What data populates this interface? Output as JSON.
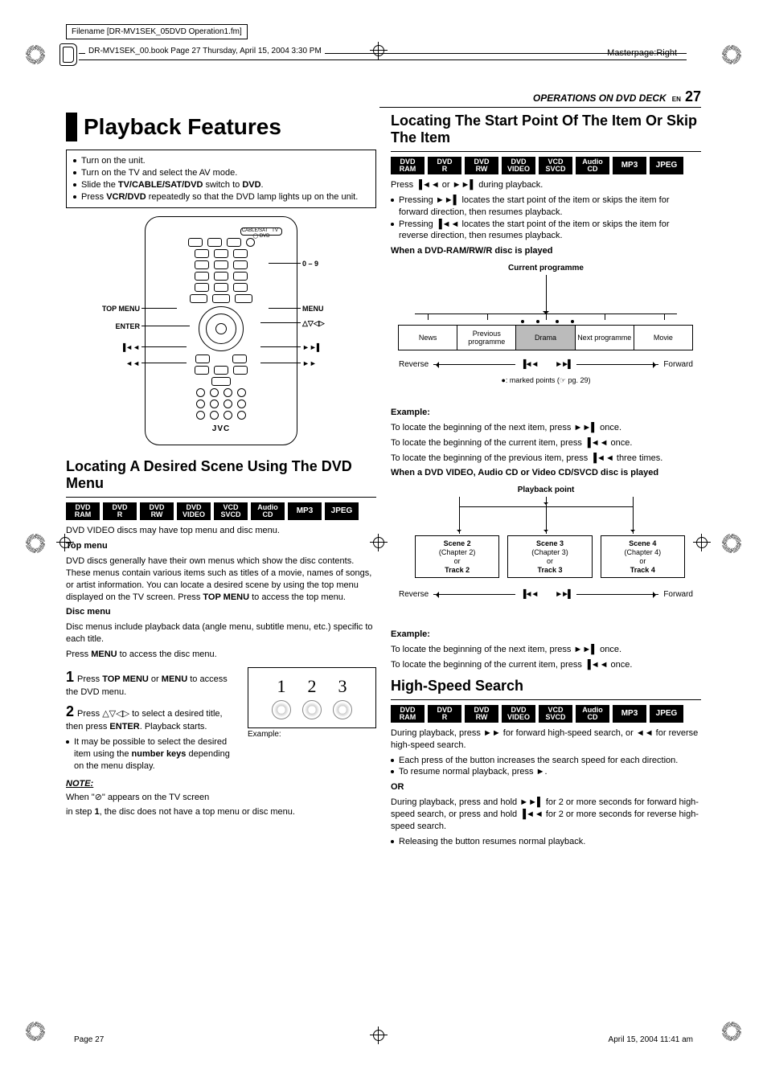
{
  "meta": {
    "filename_box": "Filename [DR-MV1SEK_05DVD Operation1.fm]",
    "bookline": "DR-MV1SEK_00.book  Page 27  Thursday, April 15, 2004  3:30 PM",
    "masterpage": "Masterpage:Right",
    "footer_left": "Page 27",
    "footer_right": "April 15, 2004 11:41 am"
  },
  "header": {
    "section": "OPERATIONS ON DVD DECK",
    "lang": "EN",
    "page": "27"
  },
  "formats": {
    "all": [
      "DVD\nRAM",
      "DVD\nR",
      "DVD\nRW",
      "DVD\nVIDEO",
      "VCD\nSVCD",
      "Audio\nCD",
      "MP3",
      "JPEG"
    ]
  },
  "left": {
    "title": "Playback Features",
    "box": {
      "b1": "Turn on the unit.",
      "b2": "Turn on the TV and select the AV mode.",
      "b3_pre": "Slide the ",
      "b3_b1": "TV/CABLE/SAT/DVD",
      "b3_mid": " switch to ",
      "b3_b2": "DVD",
      "b3_post": ".",
      "b4_pre": "Press ",
      "b4_b": "VCR/DVD",
      "b4_post": " repeatedly so that the DVD lamp lights up on the unit."
    },
    "remote": {
      "top_menu": "TOP MENU",
      "enter": "ENTER",
      "prev": "▐◄◄",
      "rew": "◄◄",
      "menu": "MENU",
      "arrows": "△▽◁▷",
      "next": "►►▌",
      "ff": "►►",
      "numlabel": "0 – 9",
      "brand": "JVC"
    },
    "h2a": "Locating A Desired Scene Using The DVD Menu",
    "p1": "DVD VIDEO discs may have top menu and disc menu.",
    "topmenu_h": "Top menu",
    "topmenu_p_pre": "DVD discs generally have their own menus which show the disc contents. These menus contain various items such as titles of a movie, names of songs, or artist information. You can locate a desired scene by using the top menu displayed on the TV screen. Press ",
    "topmenu_p_b": "TOP MENU",
    "topmenu_p_post": " to access the top menu.",
    "discmenu_h": "Disc menu",
    "discmenu_p1": "Disc menus include playback data (angle menu, subtitle menu, etc.) specific to each title.",
    "discmenu_p2_pre": "Press ",
    "discmenu_p2_b": "MENU",
    "discmenu_p2_post": " to access the disc menu.",
    "step1_pre": "Press ",
    "step1_b1": "TOP MENU",
    "step1_mid": " or ",
    "step1_b2": "MENU",
    "step1_post": " to access the DVD menu.",
    "step2_pre": "Press △▽◁▷ to select a desired title, then press ",
    "step2_b": "ENTER",
    "step2_post": ". Playback starts.",
    "step2_bul_pre": "It may be possible to select the desired item using the ",
    "step2_bul_b": "number keys",
    "step2_bul_post": " depending on the menu display.",
    "ex_caption": "Example:",
    "note_h": "NOTE:",
    "note_l1": "When \"⊘\" appears on the TV screen",
    "note_l2_pre": "in step ",
    "note_l2_b": "1",
    "note_l2_post": ", the disc does not have a top menu or disc menu."
  },
  "right": {
    "h2a": "Locating The Start Point Of The Item Or Skip The Item",
    "p1": "Press ▐◄◄ or ►►▌ during playback.",
    "b1": "Pressing ►►▌ locates the start point of the item or skips the item for forward direction, then resumes playback.",
    "b2": "Pressing ▐◄◄ locates the start point of the item or skips the item for reverse direction, then resumes playback.",
    "h3a": "When a DVD-RAM/RW/R disc is played",
    "d1": {
      "title": "Current programme",
      "cells": [
        "News",
        "Previous programme",
        "Drama",
        "Next programme",
        "Movie"
      ],
      "reverse": "Reverse",
      "forward": "Forward",
      "note": "●: marked points (☞ pg. 29)"
    },
    "ex1_h": "Example:",
    "ex1_l1": "To locate the beginning of the next item, press ►►▌ once.",
    "ex1_l2": "To locate the beginning of the current item, press ▐◄◄ once.",
    "ex1_l3": "To locate the beginning of the previous item, press ▐◄◄ three times.",
    "h3b": "When a DVD VIDEO, Audio CD or Video CD/SVCD disc is played",
    "d2": {
      "title": "Playback point",
      "cells": [
        {
          "a": "Scene 2",
          "b": "(Chapter 2)",
          "c": "or",
          "d": "Track 2"
        },
        {
          "a": "Scene 3",
          "b": "(Chapter 3)",
          "c": "or",
          "d": "Track 3"
        },
        {
          "a": "Scene 4",
          "b": "(Chapter 4)",
          "c": "or",
          "d": "Track 4"
        }
      ],
      "reverse": "Reverse",
      "forward": "Forward"
    },
    "ex2_h": "Example:",
    "ex2_l1": "To locate the beginning of the next item, press ►►▌ once.",
    "ex2_l2": "To locate the beginning of the current item, press ▐◄◄ once.",
    "h2b": "High-Speed Search",
    "hs_p1": "During playback, press ►► for forward high-speed search, or ◄◄ for reverse high-speed search.",
    "hs_b1": "Each press of the button increases the search speed for each direction.",
    "hs_b2": "To resume normal playback, press ►.",
    "or": "OR",
    "hs_p2": "During playback, press and hold ►►▌ for 2 or more seconds for forward high-speed search, or press and hold ▐◄◄ for 2 or more seconds for reverse high-speed search.",
    "hs_b3": "Releasing the button resumes normal playback."
  }
}
